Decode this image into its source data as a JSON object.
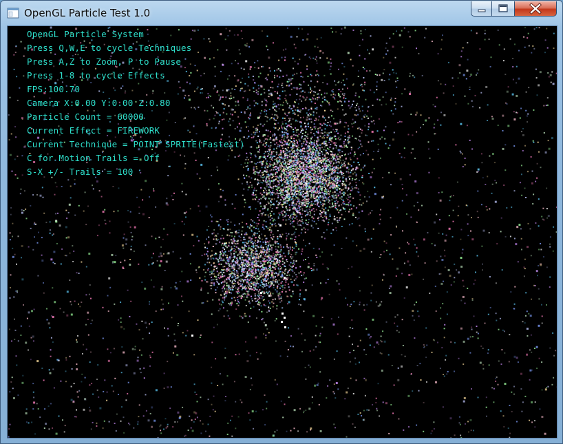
{
  "window": {
    "title": "OpenGL Particle Test 1.0",
    "icon": "application-window-icon",
    "controls": [
      "minimize-icon",
      "maximize-icon",
      "close-icon"
    ]
  },
  "hud": {
    "color": "#2ee0cc",
    "lines": [
      "OpenGL Particle System",
      "Press Q,W,E to cycle Techniques",
      "Press A,Z to Zoom, P to Pause",
      "Press 1-8 to cycle Effects",
      "FPS:100.70",
      "Camera X:0.00 Y:0.00 Z:0.80",
      "Particle Count = 60000",
      "Current Effect = FIREWORK",
      "Current Technique = POINT SPRITE(Fastest)",
      "C for Motion Trails = Off",
      "S-X +/- Trails = 100"
    ]
  },
  "scene": {
    "background": "#000000",
    "particle_colors": [
      "#ffffff",
      "#c8f0c8",
      "#ffc0d0",
      "#c0c8ff",
      "#a0ffa0",
      "#ff80c0",
      "#80a0ff",
      "#ffe0a0",
      "#60d0ff",
      "#d090ff"
    ]
  }
}
